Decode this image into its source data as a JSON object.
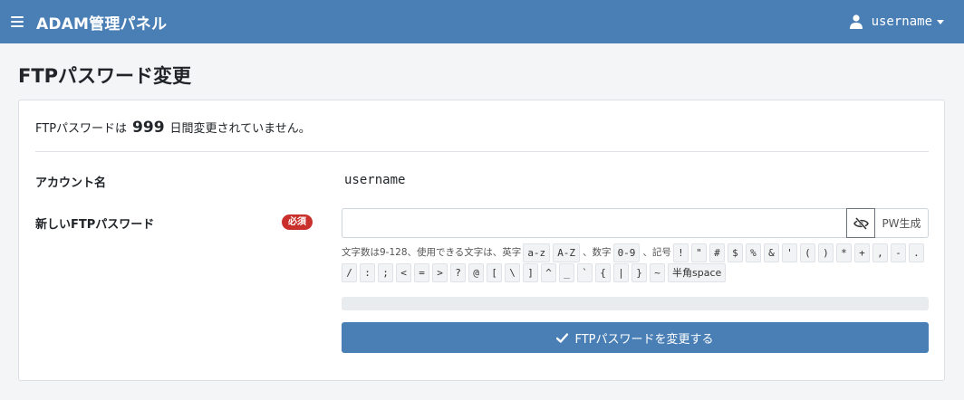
{
  "header": {
    "brand": "ADAM管理パネル",
    "username": "username",
    "menu_icon": "hamburger-icon",
    "user_icon": "user-icon",
    "background": "#4a7fb6"
  },
  "page": {
    "title": "FTPパスワード変更"
  },
  "notice": {
    "prefix": "FTPパスワードは",
    "days": "999",
    "suffix": "日間変更されていません。"
  },
  "form": {
    "account_label": "アカウント名",
    "account_value": "username",
    "password_label": "新しいFTPパスワード",
    "required_badge": "必須",
    "password_value": "",
    "password_placeholder": "",
    "toggle_icon": "eye-slash-icon",
    "generate_label": "PW生成",
    "help": {
      "intro": "文字数は9-128、使用できる文字は、英字",
      "lower": "a-z",
      "upper": "A-Z",
      "sep1": "、数字",
      "digits": "0-9",
      "sep2": "、記号",
      "symbols": [
        "!",
        "\"",
        "#",
        "$",
        "%",
        "&",
        "'",
        "(",
        ")",
        "*",
        "+",
        ",",
        "-",
        ".",
        "/",
        ":",
        ";",
        "<",
        "=",
        ">",
        "?",
        "@",
        "[",
        "\\",
        "]",
        "^",
        "_",
        "`",
        "{",
        "|",
        "}",
        "~",
        "半角space"
      ]
    },
    "strength": 0,
    "submit_label": "FTPパスワードを変更する",
    "submit_icon": "check-icon"
  },
  "colors": {
    "primary": "#4a7fb6",
    "danger": "#c9302c"
  }
}
